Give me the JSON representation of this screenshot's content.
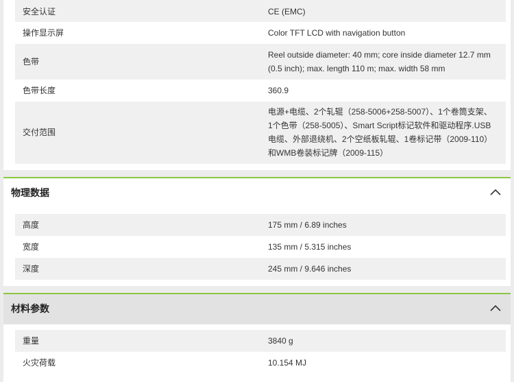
{
  "spec_top": [
    {
      "label": "安全认证",
      "value": "CE (EMC)"
    },
    {
      "label": "操作显示屏",
      "value": "Color TFT LCD with navigation button"
    },
    {
      "label": "色带",
      "value": "Reel outside diameter: 40 mm; core inside diameter 12.7 mm (0.5 inch); max. length 110 m; max. width 58 mm"
    },
    {
      "label": "色带长度",
      "value": "360.9"
    },
    {
      "label": "交付范围",
      "value": "电源+电缆、2个轧辊（258-5006+258-5007）、1个卷筒支架、1个色带（258-5005）、Smart Script标记软件和驱动程序.USB电缆、外部退绕机、2个空纸板轧辊、1卷标记带（2009-110）和WMB卷装标记牌（2009-115）"
    }
  ],
  "physical": {
    "title": "物理数据",
    "rows": [
      {
        "label": "高度",
        "value": "175 mm / 6.89 inches"
      },
      {
        "label": "宽度",
        "value": "135 mm / 5.315 inches"
      },
      {
        "label": "深度",
        "value": "245 mm / 9.646 inches"
      }
    ]
  },
  "material": {
    "title": "材料参数",
    "rows": [
      {
        "label": "重量",
        "value": "3840 g"
      },
      {
        "label": "火灾荷载",
        "value": "10.154 MJ"
      }
    ]
  },
  "icons": {
    "collapse": "chevron-up-icon"
  },
  "colors": {
    "accent": "#8cc63f",
    "row_shade": "#f0f0f0",
    "page_bg": "#ececec"
  }
}
